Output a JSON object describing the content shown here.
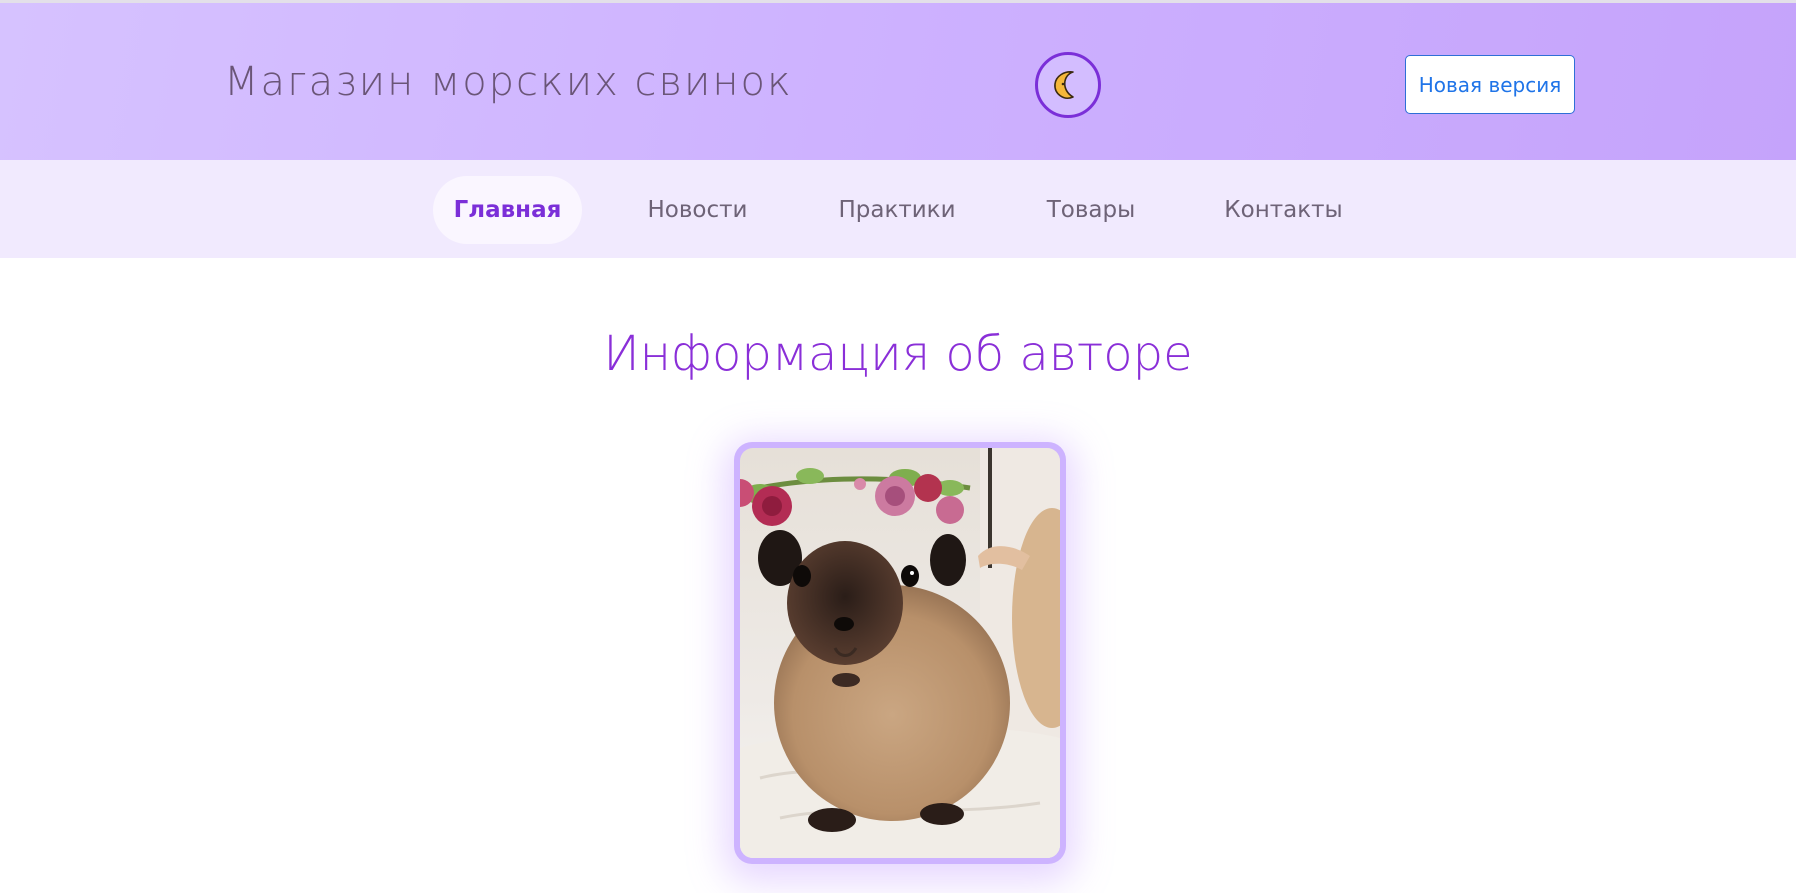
{
  "header": {
    "site_title": "Магазин морских свинок",
    "theme_toggle_icon": "moon-icon",
    "new_version_label": "Новая версия"
  },
  "nav": {
    "items": [
      {
        "label": "Главная",
        "active": true
      },
      {
        "label": "Новости",
        "active": false
      },
      {
        "label": "Практики",
        "active": false
      },
      {
        "label": "Товары",
        "active": false
      },
      {
        "label": "Контакты",
        "active": false
      }
    ]
  },
  "main": {
    "heading": "Информация об авторе"
  },
  "colors": {
    "header_gradient_start": "#d6c2ff",
    "header_gradient_end": "#c5a3fb",
    "nav_background": "#f1eafe",
    "accent": "#8a2fd8",
    "button_blue": "#1f74e8"
  }
}
